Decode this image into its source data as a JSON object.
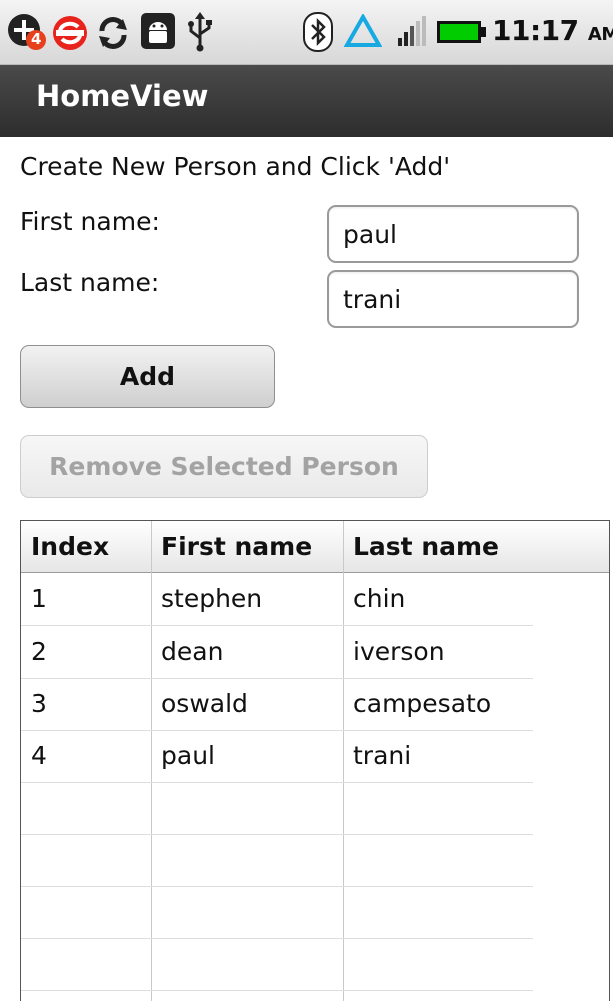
{
  "status_bar": {
    "time": "11:17",
    "ampm": "AM",
    "notification_badge": "4",
    "icons": [
      "add-notification-icon",
      "sync-error-icon",
      "sync-icon",
      "android-debug-icon",
      "usb-icon",
      "bluetooth-icon",
      "triangle-icon",
      "signal-icon",
      "battery-icon"
    ],
    "battery_color": "#00cc00"
  },
  "app": {
    "title": "HomeView"
  },
  "form": {
    "prompt": "Create New Person and Click 'Add'",
    "first_name_label": "First name:",
    "last_name_label": "Last name:",
    "first_name_value": "paul",
    "last_name_value": "trani",
    "add_label": "Add",
    "remove_label": "Remove Selected Person"
  },
  "table": {
    "headers": [
      "Index",
      "First name",
      "Last name"
    ],
    "rows": [
      [
        "1",
        "stephen",
        "chin"
      ],
      [
        "2",
        "dean",
        "iverson"
      ],
      [
        "3",
        "oswald",
        "campesato"
      ],
      [
        "4",
        "paul",
        "trani"
      ]
    ]
  }
}
